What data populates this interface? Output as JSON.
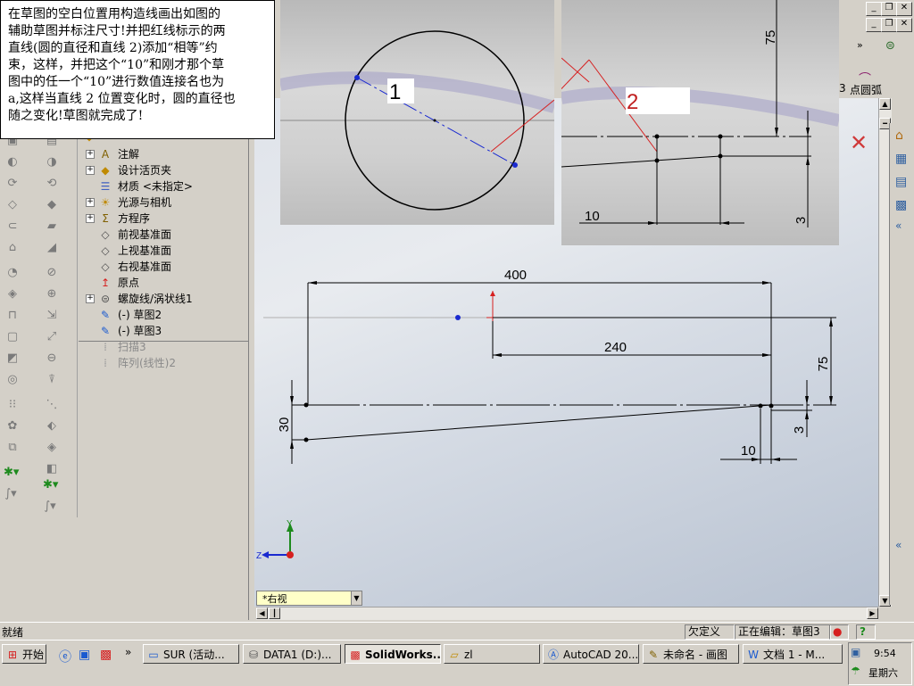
{
  "annotation": {
    "text_lines": [
      "在草图的空白位置用构造线画出如图的",
      "辅助草图并标注尺寸!并把红线标示的两",
      "直线(圆的直径和直线 2)添加“相等”约",
      "束，这样，并把这个“10”和刚才那个草",
      "图中的任一个“10”进行数值连接名也为",
      "a,这样当直线 2 位置变化时，圆的直径也",
      "随之变化!草图就完成了!"
    ]
  },
  "insets": {
    "left_marker": "1",
    "right_marker": "2",
    "right_dim_75": "75",
    "right_dim_10": "10",
    "right_dim_3": "3"
  },
  "toolbar_top": {
    "point_arc_label": "点圆弧",
    "digit_label": "3"
  },
  "feature_tree": {
    "items": [
      {
        "label": "注解",
        "icon": "annotation-icon",
        "expand": true,
        "dim": false
      },
      {
        "label": "设计活页夹",
        "icon": "design-binder-icon",
        "expand": true,
        "dim": false
      },
      {
        "label": "材质 <未指定>",
        "icon": "material-icon",
        "expand": false,
        "dim": false
      },
      {
        "label": "光源与相机",
        "icon": "lights-camera-icon",
        "expand": true,
        "dim": false
      },
      {
        "label": "方程序",
        "icon": "equations-icon",
        "expand": true,
        "dim": false
      },
      {
        "label": "前视基准面",
        "icon": "plane-icon",
        "expand": false,
        "dim": false
      },
      {
        "label": "上视基准面",
        "icon": "plane-icon",
        "expand": false,
        "dim": false
      },
      {
        "label": "右视基准面",
        "icon": "plane-icon",
        "expand": false,
        "dim": false
      },
      {
        "label": "原点",
        "icon": "origin-icon",
        "expand": false,
        "dim": false
      },
      {
        "label": "螺旋线/涡状线1",
        "icon": "helix-icon",
        "expand": true,
        "dim": false
      },
      {
        "label": "(-) 草图2",
        "icon": "sketch-icon",
        "expand": false,
        "dim": false
      },
      {
        "label": "(-) 草图3",
        "icon": "sketch-icon",
        "expand": false,
        "dim": false
      },
      {
        "label": "扫描3",
        "icon": "rollback-icon",
        "expand": false,
        "dim": true
      },
      {
        "label": "阵列(线性)2",
        "icon": "rollback-icon",
        "expand": false,
        "dim": true
      }
    ]
  },
  "sketch": {
    "dim_400": "400",
    "dim_240": "240",
    "dim_75": "75",
    "dim_30": "30",
    "dim_3": "3",
    "dim_10": "10",
    "axis_y": "Y",
    "axis_z": "Z"
  },
  "view_selector": {
    "value": "*右视"
  },
  "status_bar": {
    "left": "就绪",
    "state": "欠定义",
    "editing": "正在编辑：草图3"
  },
  "taskbar": {
    "start_label": "开始",
    "more_label": "»",
    "buttons": [
      {
        "label": "SUR (活动...",
        "icon": "window-icon",
        "active": false
      },
      {
        "label": "DATA1 (D:)...",
        "icon": "drive-icon",
        "active": false
      },
      {
        "label": "SolidWorks...",
        "icon": "solidworks-icon",
        "active": true
      },
      {
        "label": "zl",
        "icon": "folder-icon",
        "active": false
      },
      {
        "label": "AutoCAD 20...",
        "icon": "autocad-icon",
        "active": false
      },
      {
        "label": "未命名 - 画图",
        "icon": "paint-icon",
        "active": false
      },
      {
        "label": "文档 1 - M...",
        "icon": "word-icon",
        "active": false
      }
    ],
    "clock": "9:54",
    "day": "星期六"
  }
}
